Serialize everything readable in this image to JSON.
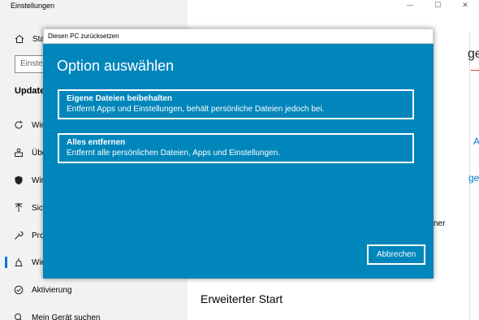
{
  "window": {
    "title": "Einstellungen",
    "minimize_glyph": "—",
    "maximize_glyph": "☐",
    "close_glyph": "✕"
  },
  "sidebar": {
    "home_label": "Sta",
    "search_placeholder": "Einste",
    "section_title": "Update",
    "items": [
      {
        "icon": "refresh-icon",
        "label": "Win"
      },
      {
        "icon": "delivery-optimization-icon",
        "label": "Übe"
      },
      {
        "icon": "shield-icon",
        "label": "Win"
      },
      {
        "icon": "backup-icon",
        "label": "Sich"
      },
      {
        "icon": "troubleshoot-icon",
        "label": "Pro"
      },
      {
        "icon": "recovery-icon",
        "label": "Wie"
      },
      {
        "icon": "activation-icon",
        "label": "Aktivierung"
      },
      {
        "icon": "find-device-icon",
        "label": "Mein Gerät suchen"
      }
    ]
  },
  "main": {
    "frag_1": "ge",
    "frag_2": "A",
    "frag_3": "ge",
    "frag_4": "ner",
    "advanced_start_heading": "Erweiterter Start"
  },
  "dialog": {
    "title": "Diesen PC zurücksetzen",
    "heading": "Option auswählen",
    "options": [
      {
        "title": "Eigene Dateien beibehalten",
        "description": "Entfernt Apps und Einstellungen, behält persönliche Dateien jedoch bei."
      },
      {
        "title": "Alles entfernen",
        "description": "Entfernt alle persönlichen Dateien, Apps und Einstellungen."
      }
    ],
    "cancel_label": "Abbrechen"
  },
  "colors": {
    "dialog_background": "#0086bb",
    "accent": "#0078d7"
  }
}
